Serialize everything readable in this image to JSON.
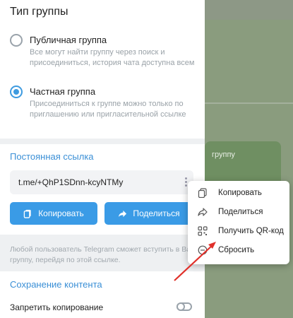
{
  "group_type": {
    "title": "Тип группы",
    "options": [
      {
        "title": "Публичная группа",
        "description": "Все могут найти группу через поиск и присоединиться, история чата доступна всем",
        "checked": false
      },
      {
        "title": "Частная группа",
        "description": "Присоединиться к группе можно только по приглашению или пригласительной ссылке",
        "checked": true
      }
    ]
  },
  "permanent_link": {
    "title": "Постоянная ссылка",
    "link": "t.me/+QhP1SDnn-kcyNTMy",
    "copy_label": "Копировать",
    "share_label": "Поделиться",
    "hint": "Любой пользователь Telegram сможет вступить в Вашу группу, перейдя по этой ссылке."
  },
  "content_saving": {
    "title": "Сохранение контента",
    "restrict_copy_label": "Запретить копирование",
    "restrict_copy_enabled": false
  },
  "context_menu": {
    "items": [
      {
        "label": "Копировать",
        "icon": "copy-icon"
      },
      {
        "label": "Поделиться",
        "icon": "share-icon"
      },
      {
        "label": "Получить QR-код",
        "icon": "qr-code-icon"
      },
      {
        "label": "Сбросить",
        "icon": "reset-icon"
      }
    ]
  },
  "background_chat": {
    "bubble_text": "группу"
  },
  "colors": {
    "accent": "#3a9be6",
    "section_title": "#3a8fd6",
    "arrow": "#e0302a"
  }
}
